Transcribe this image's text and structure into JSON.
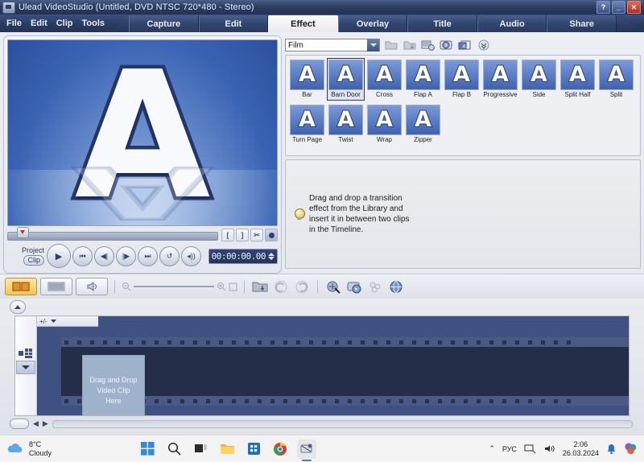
{
  "window": {
    "title": "Ulead VideoStudio (Untitled, DVD NTSC 720*480 - Stereo)",
    "app_icon": "camera-icon",
    "help_label": "?",
    "minimize_label": "_",
    "close_label": "✕"
  },
  "menu": {
    "items": [
      {
        "label": "File"
      },
      {
        "label": "Edit"
      },
      {
        "label": "Clip"
      },
      {
        "label": "Tools"
      }
    ]
  },
  "step_tabs": [
    {
      "label": "Capture",
      "active": false
    },
    {
      "label": "Edit",
      "active": false
    },
    {
      "label": "Effect",
      "active": true
    },
    {
      "label": "Overlay",
      "active": false
    },
    {
      "label": "Title",
      "active": false
    },
    {
      "label": "Audio",
      "active": false
    },
    {
      "label": "Share",
      "active": false
    }
  ],
  "preview": {
    "letter": "A",
    "mode_project": "Project",
    "mode_clip": "Clip",
    "timecode": "00:00:00.00",
    "controls": [
      {
        "name": "play-button",
        "glyph": "▶"
      },
      {
        "name": "start-button",
        "glyph": "⏮"
      },
      {
        "name": "previous-frame-button",
        "glyph": "◀|"
      },
      {
        "name": "next-frame-button",
        "glyph": "|▶"
      },
      {
        "name": "end-button",
        "glyph": "⏭"
      },
      {
        "name": "repeat-button",
        "glyph": "↺"
      },
      {
        "name": "volume-button",
        "glyph": "◂))"
      }
    ],
    "trim_buttons": [
      {
        "name": "mark-in-button",
        "glyph": "["
      },
      {
        "name": "mark-out-button",
        "glyph": "]"
      },
      {
        "name": "cut-clip-button",
        "glyph": "✂"
      },
      {
        "name": "enlarge-preview-button",
        "glyph": "◉"
      }
    ]
  },
  "library": {
    "category": "Film",
    "toolbar_icons": [
      {
        "name": "open-folder-icon"
      },
      {
        "name": "add-to-library-icon"
      },
      {
        "name": "library-options-icon"
      },
      {
        "name": "properties-icon"
      },
      {
        "name": "duplicate-icon"
      },
      {
        "name": "expand-icon"
      }
    ],
    "transitions": [
      {
        "label": "Bar",
        "selected": false
      },
      {
        "label": "Barn Door",
        "selected": true
      },
      {
        "label": "Cross",
        "selected": false
      },
      {
        "label": "Flap A",
        "selected": false
      },
      {
        "label": "Flap B",
        "selected": false
      },
      {
        "label": "Progressive",
        "selected": false
      },
      {
        "label": "Side",
        "selected": false
      },
      {
        "label": "Split Half",
        "selected": false
      },
      {
        "label": "Split",
        "selected": false
      },
      {
        "label": "Turn Page",
        "selected": false
      },
      {
        "label": "Twist",
        "selected": false
      },
      {
        "label": "Wrap",
        "selected": false
      },
      {
        "label": "Zipper",
        "selected": false
      }
    ],
    "hint": "Drag and drop a transition\neffect from the Library and\ninsert it in between two clips\nin the Timeline."
  },
  "toolbar": {
    "view_buttons": [
      {
        "name": "storyboard-view-button",
        "selected": true
      },
      {
        "name": "timeline-view-button",
        "selected": false
      },
      {
        "name": "audio-view-button",
        "selected": false
      }
    ],
    "tools": [
      {
        "name": "insert-media-icon"
      },
      {
        "name": "undo-icon"
      },
      {
        "name": "redo-icon"
      },
      {
        "name": "smart-proxy-icon"
      },
      {
        "name": "project-playback-icon"
      },
      {
        "name": "batch-convert-icon"
      },
      {
        "name": "export-icon"
      }
    ]
  },
  "timeline": {
    "clip_placeholder": "Drag and Drop\nVideo Clip\nHere",
    "track_icons": [
      {
        "name": "video-track-icon"
      },
      {
        "name": "track-expand-icon"
      }
    ],
    "zoom_label": "+/-"
  },
  "taskbar": {
    "weather_temp": "8°C",
    "weather_desc": "Cloudy",
    "apps": [
      {
        "name": "start-button"
      },
      {
        "name": "search-icon"
      },
      {
        "name": "task-view-icon"
      },
      {
        "name": "file-explorer-icon"
      },
      {
        "name": "microsoft-store-icon"
      },
      {
        "name": "chrome-icon"
      },
      {
        "name": "videostudio-taskbar-icon"
      }
    ],
    "tray_chevron": "⌃",
    "language": "РУС",
    "time": "2:06",
    "date": "26.03.2024"
  },
  "colors": {
    "titlebar": "#2c3e63",
    "accent": "#3a63b4",
    "selected": "#f4c54e"
  }
}
